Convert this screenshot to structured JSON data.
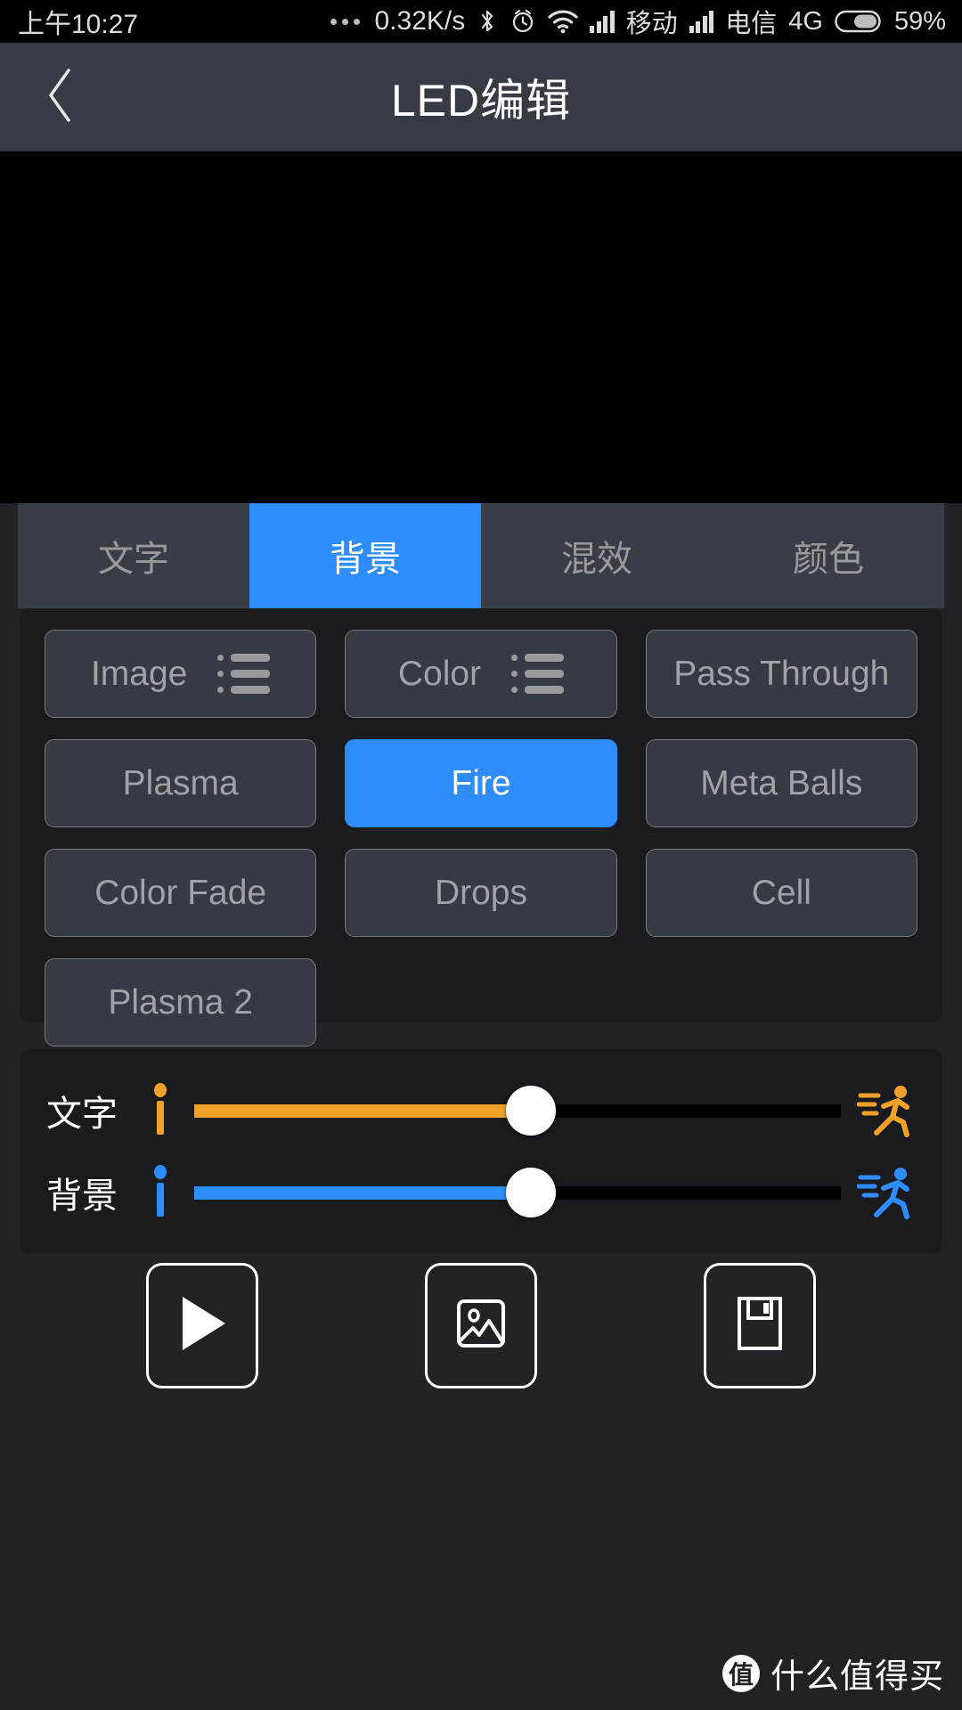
{
  "statusbar": {
    "time": "上午10:27",
    "network_speed": "0.32K/s",
    "carrier1": "移动",
    "carrier2": "电信",
    "network_type": "4G",
    "battery": "59%",
    "icons": [
      "more-dots-icon",
      "bluetooth-icon",
      "alarm-clock-icon",
      "wifi-icon",
      "signal-icon",
      "signal-icon",
      "battery-icon"
    ]
  },
  "titlebar": {
    "back_icon": "chevron-left-icon",
    "title": "LED编辑"
  },
  "tabs": [
    {
      "label": "文字",
      "active": false
    },
    {
      "label": "背景",
      "active": true
    },
    {
      "label": "混效",
      "active": false
    },
    {
      "label": "颜色",
      "active": false
    }
  ],
  "effects": [
    {
      "label": "Image",
      "active": false,
      "icon": "list-icon"
    },
    {
      "label": "Color",
      "active": false,
      "icon": "list-icon"
    },
    {
      "label": "Pass Through",
      "active": false,
      "icon": null
    },
    {
      "label": "Plasma",
      "active": false,
      "icon": null
    },
    {
      "label": "Fire",
      "active": true,
      "icon": null
    },
    {
      "label": "Meta Balls",
      "active": false,
      "icon": null
    },
    {
      "label": "Color Fade",
      "active": false,
      "icon": null
    },
    {
      "label": "Drops",
      "active": false,
      "icon": null
    },
    {
      "label": "Cell",
      "active": false,
      "icon": null
    },
    {
      "label": "Plasma 2",
      "active": false,
      "icon": null
    }
  ],
  "sliders": [
    {
      "label": "文字",
      "color": "#f0a12a",
      "value_percent": 52,
      "left_icon": "standing-person-icon",
      "right_icon": "running-person-icon"
    },
    {
      "label": "背景",
      "color": "#2e8dfb",
      "value_percent": 52,
      "left_icon": "standing-person-icon",
      "right_icon": "running-person-icon"
    }
  ],
  "actions": [
    {
      "icon": "play-icon",
      "name": "play-button"
    },
    {
      "icon": "image-icon",
      "name": "image-button"
    },
    {
      "icon": "save-floppy-icon",
      "name": "save-button"
    }
  ],
  "watermark": {
    "logo": "值",
    "text": "什么值得买"
  },
  "colors": {
    "accent_blue": "#2e8dfb",
    "accent_orange": "#f0a12a",
    "panel_bg": "#1a1b1f",
    "button_bg": "#363a43",
    "titlebar_bg": "#373b44",
    "page_bg": "#212226"
  }
}
